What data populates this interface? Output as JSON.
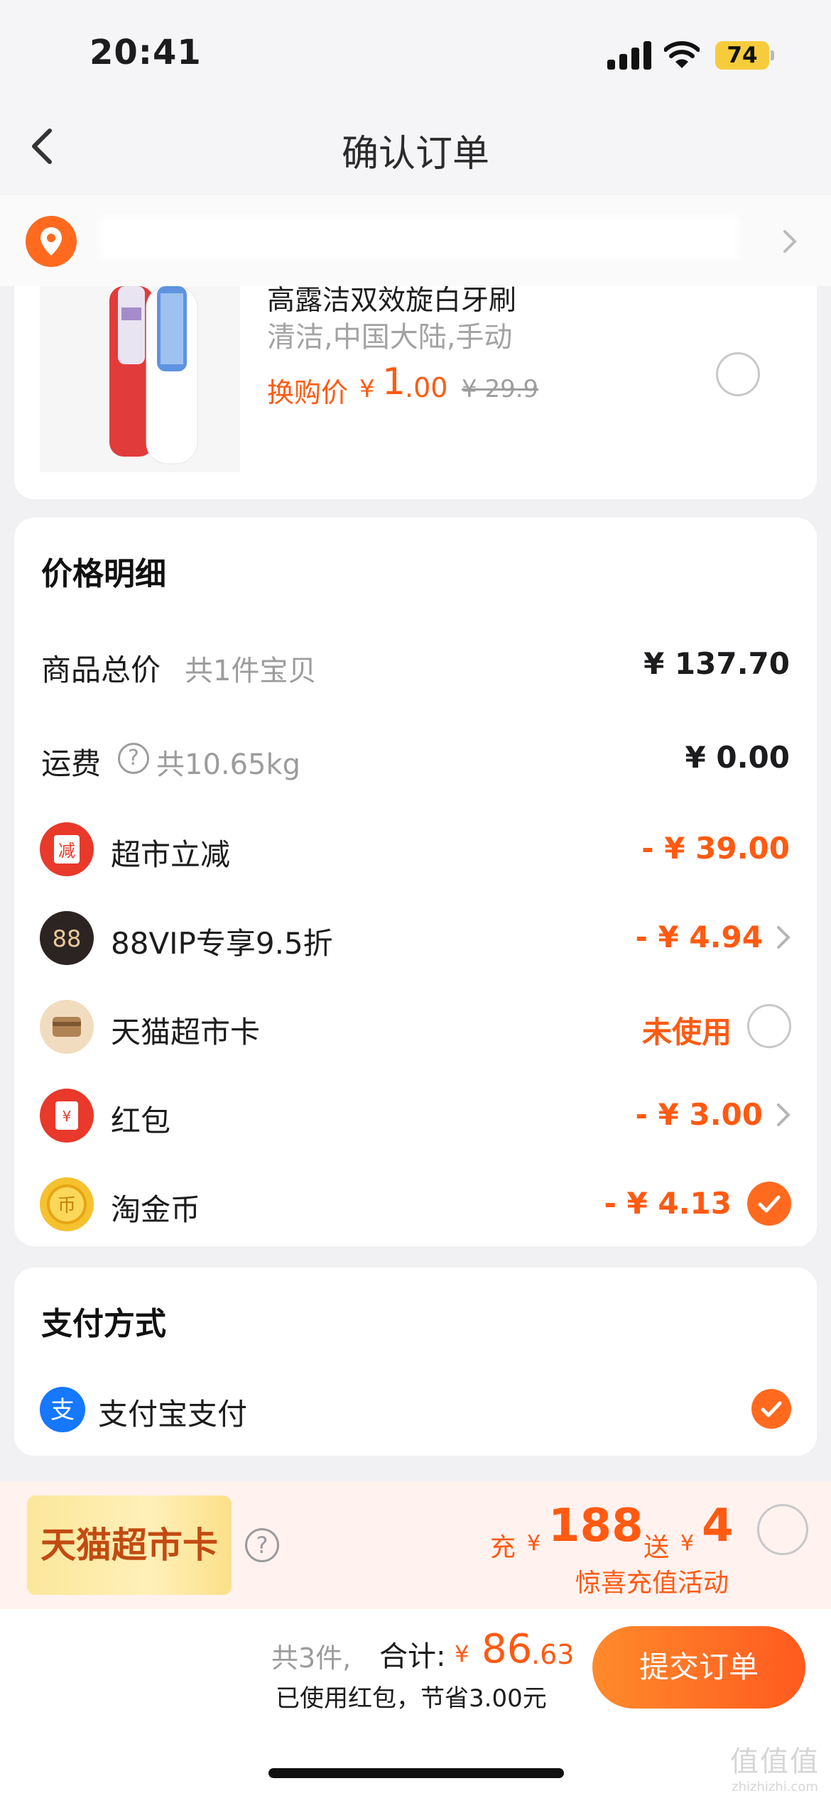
{
  "status_bar": {
    "time": "20:41",
    "battery": "74"
  },
  "nav": {
    "title": "确认订单"
  },
  "product": {
    "name": "高露洁双效旋白牙刷",
    "spec": "清洁,中国大陆,手动",
    "swap_label": "换购价",
    "currency": "¥",
    "price_int": "1",
    "price_dec": ".00",
    "original_price": "¥ 29.9",
    "selected": false
  },
  "price_detail": {
    "title": "价格明细",
    "total_label": "商品总价",
    "total_count": "共1件宝贝",
    "total_value": "¥ 137.70",
    "shipping_label": "运费",
    "shipping_weight": "共10.65kg",
    "shipping_value": "¥ 0.00",
    "discounts": [
      {
        "icon": "jian-icon",
        "label": "超市立减",
        "value": "- ¥ 39.00"
      },
      {
        "icon": "88vip-icon",
        "label": "88VIP专享9.5折",
        "value": "- ¥ 4.94"
      },
      {
        "icon": "card-icon",
        "label": "天猫超市卡",
        "value": "未使用"
      },
      {
        "icon": "red-envelope-icon",
        "label": "红包",
        "value": "- ¥ 3.00"
      },
      {
        "icon": "coin-icon",
        "label": "淘金币",
        "value": "- ¥ 4.13"
      }
    ]
  },
  "payment": {
    "title": "支付方式",
    "method": "支付宝支付",
    "selected": true
  },
  "promo": {
    "badge": "天猫超市卡",
    "recharge_label": "充",
    "currency": "¥",
    "recharge_amount": "188",
    "gift_label": "送",
    "gift_amount": "4",
    "subtitle": "惊喜充值活动"
  },
  "footer": {
    "count": "共3件,",
    "total_label": "合计:",
    "currency": "¥",
    "total_int": "86",
    "total_dec": ".63",
    "savings": "已使用红包，节省3.00元",
    "submit_label": "提交订单"
  },
  "watermark": {
    "text": "值值值",
    "sub": "zhizhizhi.com"
  },
  "colors": {
    "accent": "#ff5a12",
    "button_start": "#ff8a2b",
    "button_end": "#ff5a1f"
  }
}
